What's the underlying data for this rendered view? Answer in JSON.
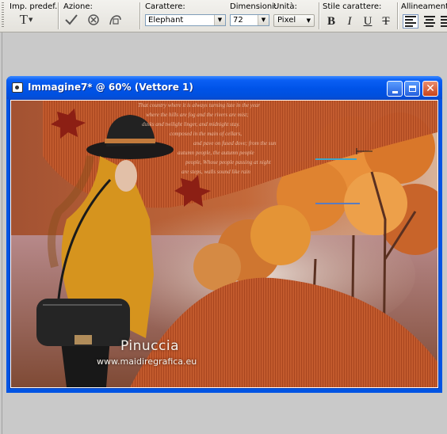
{
  "toolbar": {
    "presets_label": "Imp. predef.:",
    "actions_label": "Azione:",
    "font_label": "Carattere:",
    "font_value": "Elephant",
    "size_label": "Dimensioni:",
    "size_value": "72",
    "unit_label": "Unità:",
    "unit_value": "Pixel",
    "style_label": "Stile carattere:",
    "align_label": "Allineamento:",
    "style_buttons": [
      "B",
      "I",
      "U",
      "T"
    ]
  },
  "document": {
    "title": "Immagine7* @  60% (Vettore 1)",
    "watermark_name": "Pinuccia",
    "watermark_site": "www.maidiregrafica.eu",
    "poem_lines": [
      "That country where it is always turning late in the year",
      "where the hills are fog and the rivers are mist;",
      "dusks and twilight linger, and midnight stay.",
      "composed in the main of cellars,",
      "and pave on fused dove; from the sun",
      "autumn people, the autumn people",
      "people, Whose people passing at night",
      "are steps, walls sound like rain"
    ]
  }
}
